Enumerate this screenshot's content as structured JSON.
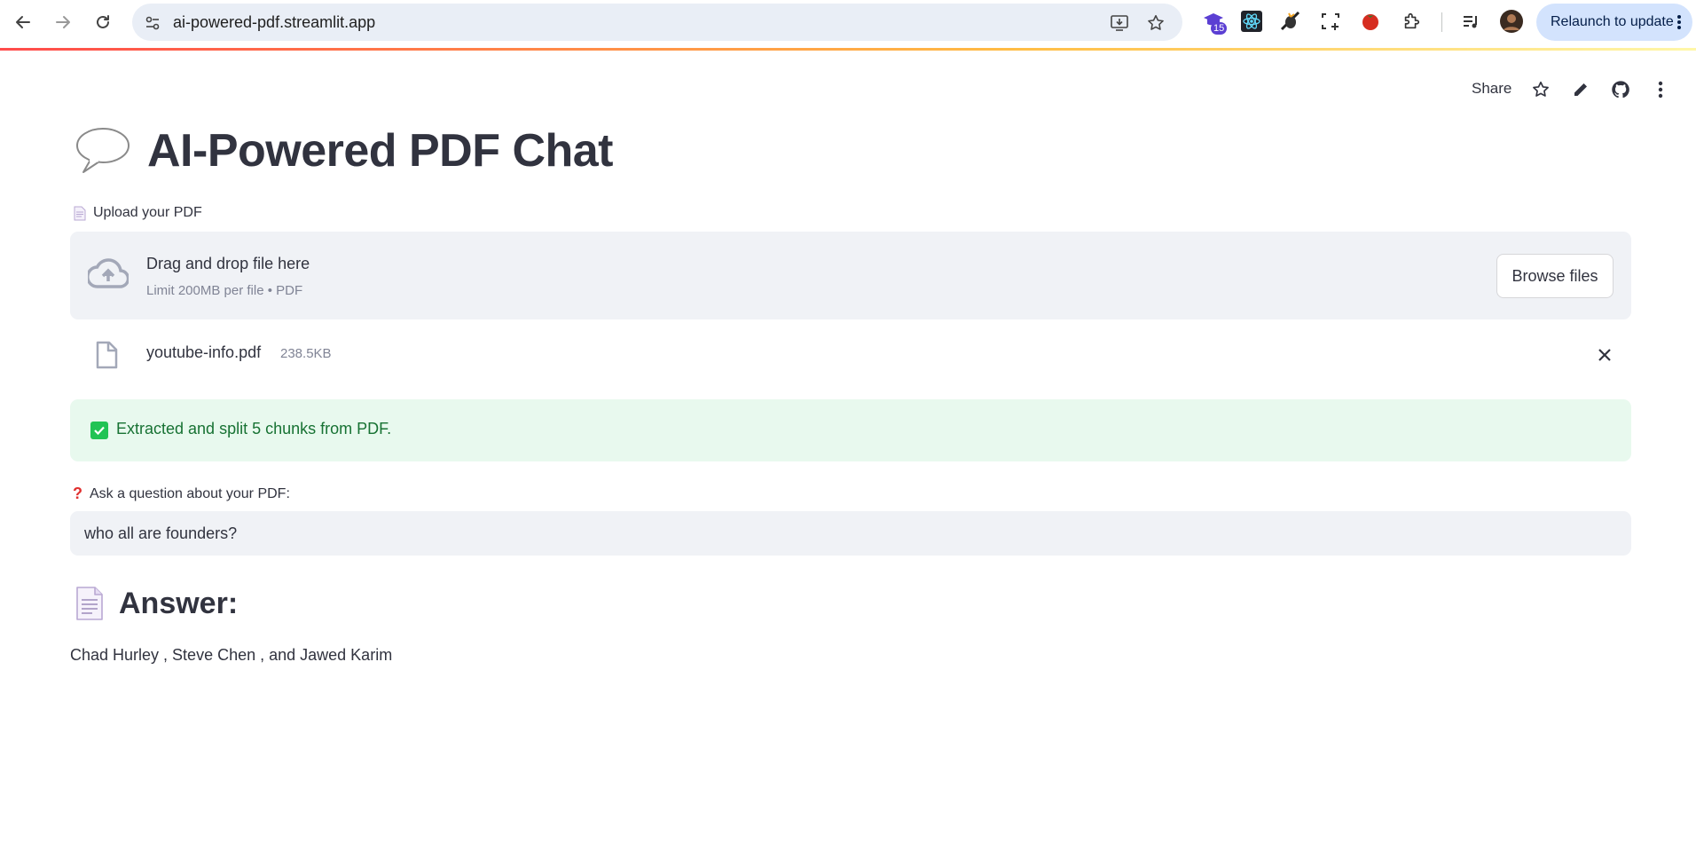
{
  "browser": {
    "url": "ai-powered-pdf.streamlit.app",
    "extension_badge": "15",
    "relaunch_label": "Relaunch to update"
  },
  "toolbar": {
    "share_label": "Share"
  },
  "app": {
    "title": "AI-Powered PDF Chat",
    "upload_label": "Upload your PDF",
    "dropzone": {
      "main": "Drag and drop file here",
      "sub": "Limit 200MB per file • PDF",
      "browse_label": "Browse files"
    },
    "file": {
      "name": "youtube-info.pdf",
      "size": "238.5KB"
    },
    "success_message": "Extracted and split 5 chunks from PDF.",
    "question_label": "Ask a question about your PDF:",
    "question_value": "who all are founders?",
    "answer_heading": "Answer:",
    "answer_text": "Chad Hurley , Steve Chen , and Jawed Karim"
  },
  "colors": {
    "accent": "#ff4b4b",
    "success_bg": "#e8f9ee",
    "success_text": "#177233",
    "input_bg": "#f0f2f6"
  }
}
